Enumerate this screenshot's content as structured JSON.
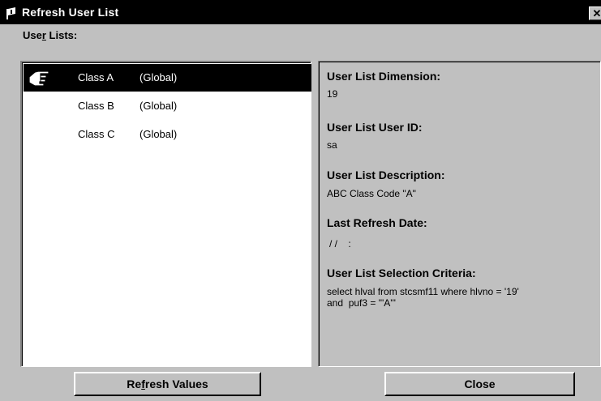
{
  "window": {
    "title": "Refresh User List",
    "close_glyph": "✕"
  },
  "lists": {
    "label_pre": "Use",
    "label_accel": "r",
    "label_post": " Lists:",
    "items": [
      {
        "name": "Class A",
        "scope": "(Global)",
        "selected": true
      },
      {
        "name": "Class B",
        "scope": "(Global)",
        "selected": false
      },
      {
        "name": "Class C",
        "scope": "(Global)",
        "selected": false
      }
    ]
  },
  "details": {
    "dimension_label": "User List Dimension:",
    "dimension_value": "19",
    "userid_label": "User List User ID:",
    "userid_value": "sa",
    "description_label": "User List Description:",
    "description_value": "ABC Class Code \"A\"",
    "refresh_label": "Last Refresh Date:",
    "refresh_value": "/ /    :",
    "criteria_label": "User List Selection Criteria:",
    "criteria_line1": "select hlval from stcsmf11 where hlvno = '19'",
    "criteria_line2": "and  puf3 = \"'A'\""
  },
  "buttons": {
    "refresh_pre": "Re",
    "refresh_accel": "f",
    "refresh_post": "resh Values",
    "close_label": "Close"
  },
  "icons": {
    "app": "app-flag-icon",
    "pointer": "pointing-hand-icon"
  }
}
